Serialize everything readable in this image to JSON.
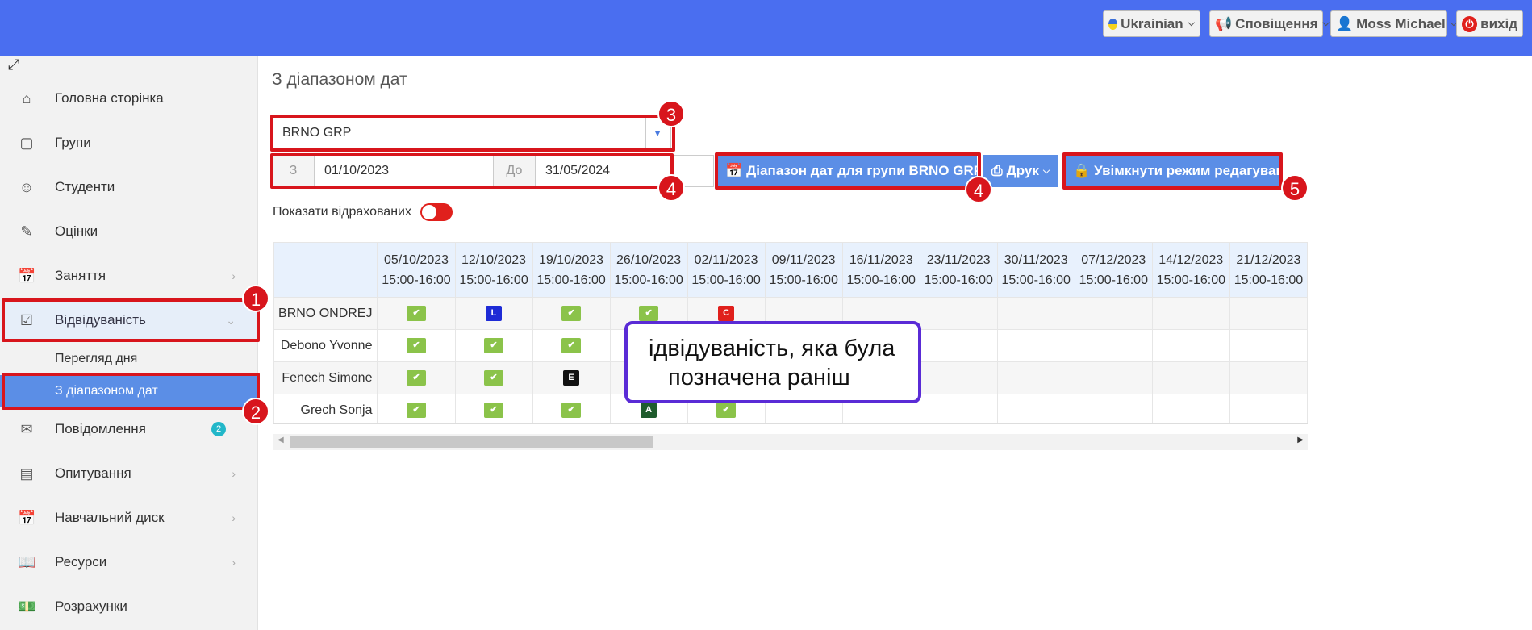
{
  "header": {
    "language": "Ukrainian",
    "notifications": "Сповіщення",
    "user": "Moss Michael",
    "logout": "вихід"
  },
  "sidebar": {
    "items": [
      {
        "label": "Головна сторінка",
        "icon": "home-icon"
      },
      {
        "label": "Групи",
        "icon": "cube-icon"
      },
      {
        "label": "Студенти",
        "icon": "user-icon"
      },
      {
        "label": "Оцінки",
        "icon": "grades-icon"
      },
      {
        "label": "Заняття",
        "icon": "calendar-icon"
      },
      {
        "label": "Відвідуваність",
        "icon": "checkbox-icon"
      },
      {
        "label": "Повідомлення",
        "icon": "envelope-icon",
        "badge": "2"
      },
      {
        "label": "Опитування",
        "icon": "receipt-icon"
      },
      {
        "label": "Навчальний диск",
        "icon": "calendar-icon"
      },
      {
        "label": "Ресурси",
        "icon": "book-icon"
      },
      {
        "label": "Розрахунки",
        "icon": "money-icon"
      }
    ],
    "subitems": [
      {
        "label": "Перегляд дня"
      },
      {
        "label": "З діапазоном дат"
      }
    ]
  },
  "main": {
    "title": "З діапазоном дат",
    "group_select": "BRNO GRP",
    "from_label": "З",
    "from_date": "01/10/2023",
    "to_label": "До",
    "to_date": "31/05/2024",
    "range_button": "Діапазон дат для групи BRNO GRP",
    "print_button": "Друк",
    "edit_button": "Увімкнути режим редагування",
    "show_withdrawn": "Показати відрахованих"
  },
  "attendance": {
    "dates": [
      "05/10/2023",
      "12/10/2023",
      "19/10/2023",
      "26/10/2023",
      "02/11/2023",
      "09/11/2023",
      "16/11/2023",
      "23/11/2023",
      "30/11/2023",
      "07/12/2023",
      "14/12/2023",
      "21/12/2023"
    ],
    "time": "15:00-16:00",
    "students": [
      {
        "name": "BRNO ONDREJ",
        "marks": [
          "ok",
          "L",
          "ok",
          "ok",
          "C",
          "",
          "",
          "",
          "",
          "",
          "",
          ""
        ]
      },
      {
        "name": "Debono Yvonne",
        "marks": [
          "ok",
          "ok",
          "ok",
          "",
          "",
          "",
          "",
          "",
          "",
          "",
          "",
          ""
        ]
      },
      {
        "name": "Fenech Simone",
        "marks": [
          "ok",
          "ok",
          "E",
          "",
          "",
          "",
          "",
          "",
          "",
          "",
          "",
          ""
        ]
      },
      {
        "name": "Grech Sonja",
        "marks": [
          "ok",
          "ok",
          "ok",
          "A",
          "ok",
          "",
          "",
          "",
          "",
          "",
          "",
          ""
        ]
      }
    ]
  },
  "annotations": {
    "numbers": [
      "1",
      "2",
      "3",
      "4",
      "4",
      "5"
    ],
    "callout_line1": "ідвідуваність, яка була",
    "callout_line2": "позначена раніш"
  },
  "colors": {
    "topbar": "#4a6ef0",
    "accent": "#5b8ee6",
    "annotation_red": "#d8151c",
    "callout_border": "#5a2bd6",
    "present_green": "#8bc34a"
  }
}
